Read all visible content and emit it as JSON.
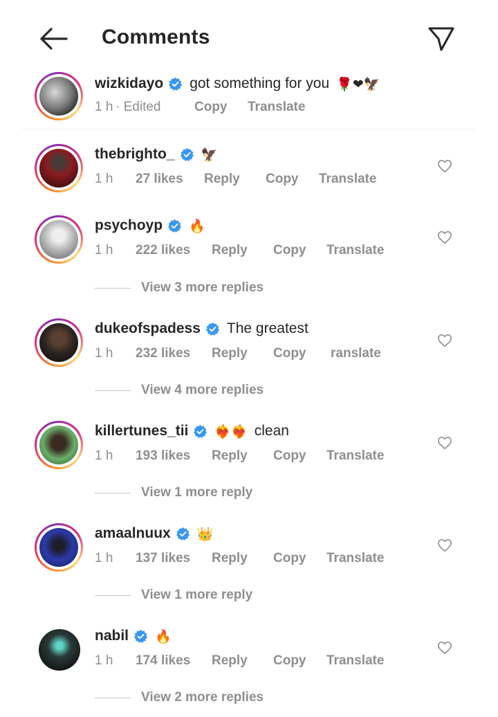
{
  "header": {
    "title": "Comments",
    "back_icon": "arrow-left-icon",
    "send_icon": "paper-plane-icon"
  },
  "caption": {
    "username": "wizkidayo",
    "text": "got something for you",
    "emojis": "🌹❤🦅",
    "time": "1 h",
    "edited": "· Edited",
    "copy": "Copy",
    "translate": "Translate"
  },
  "comments": [
    {
      "username": "thebrighto_",
      "text": "",
      "emojis": "🦅",
      "time": "1 h",
      "likes": "27 likes",
      "reply": "Reply",
      "copy": "Copy",
      "translate": "Translate",
      "more_replies": ""
    },
    {
      "username": "psychoyp",
      "text": "",
      "emojis": "🔥",
      "time": "1 h",
      "likes": "222 likes",
      "reply": "Reply",
      "copy": "Copy",
      "translate": "Translate",
      "more_replies": "View 3 more replies"
    },
    {
      "username": "dukeofspadess",
      "text": "The greatest",
      "emojis": "",
      "time": "1 h",
      "likes": "232 likes",
      "reply": "Reply",
      "copy": "Copy",
      "translate": "ranslate",
      "more_replies": "View 4 more replies"
    },
    {
      "username": "killertunes_tii",
      "text": "clean",
      "emojis": "❤‍🔥❤‍🔥",
      "time": "1 h",
      "likes": "193 likes",
      "reply": "Reply",
      "copy": "Copy",
      "translate": "Translate",
      "more_replies": "View 1 more reply"
    },
    {
      "username": "amaalnuux",
      "text": "",
      "emojis": "👑",
      "time": "1 h",
      "likes": "137 likes",
      "reply": "Reply",
      "copy": "Copy",
      "translate": "Translate",
      "more_replies": "View 1 more reply"
    },
    {
      "username": "nabil",
      "text": "",
      "emojis": "🔥",
      "time": "1 h",
      "likes": "174 likes",
      "reply": "Reply",
      "copy": "Copy",
      "translate": "Translate",
      "more_replies": "View 2 more replies"
    }
  ],
  "colors": {
    "verified": "#3897f0",
    "muted": "#8e8e8e",
    "text": "#262626",
    "ring_start": "#f58529",
    "ring_mid": "#dd2a7b"
  }
}
